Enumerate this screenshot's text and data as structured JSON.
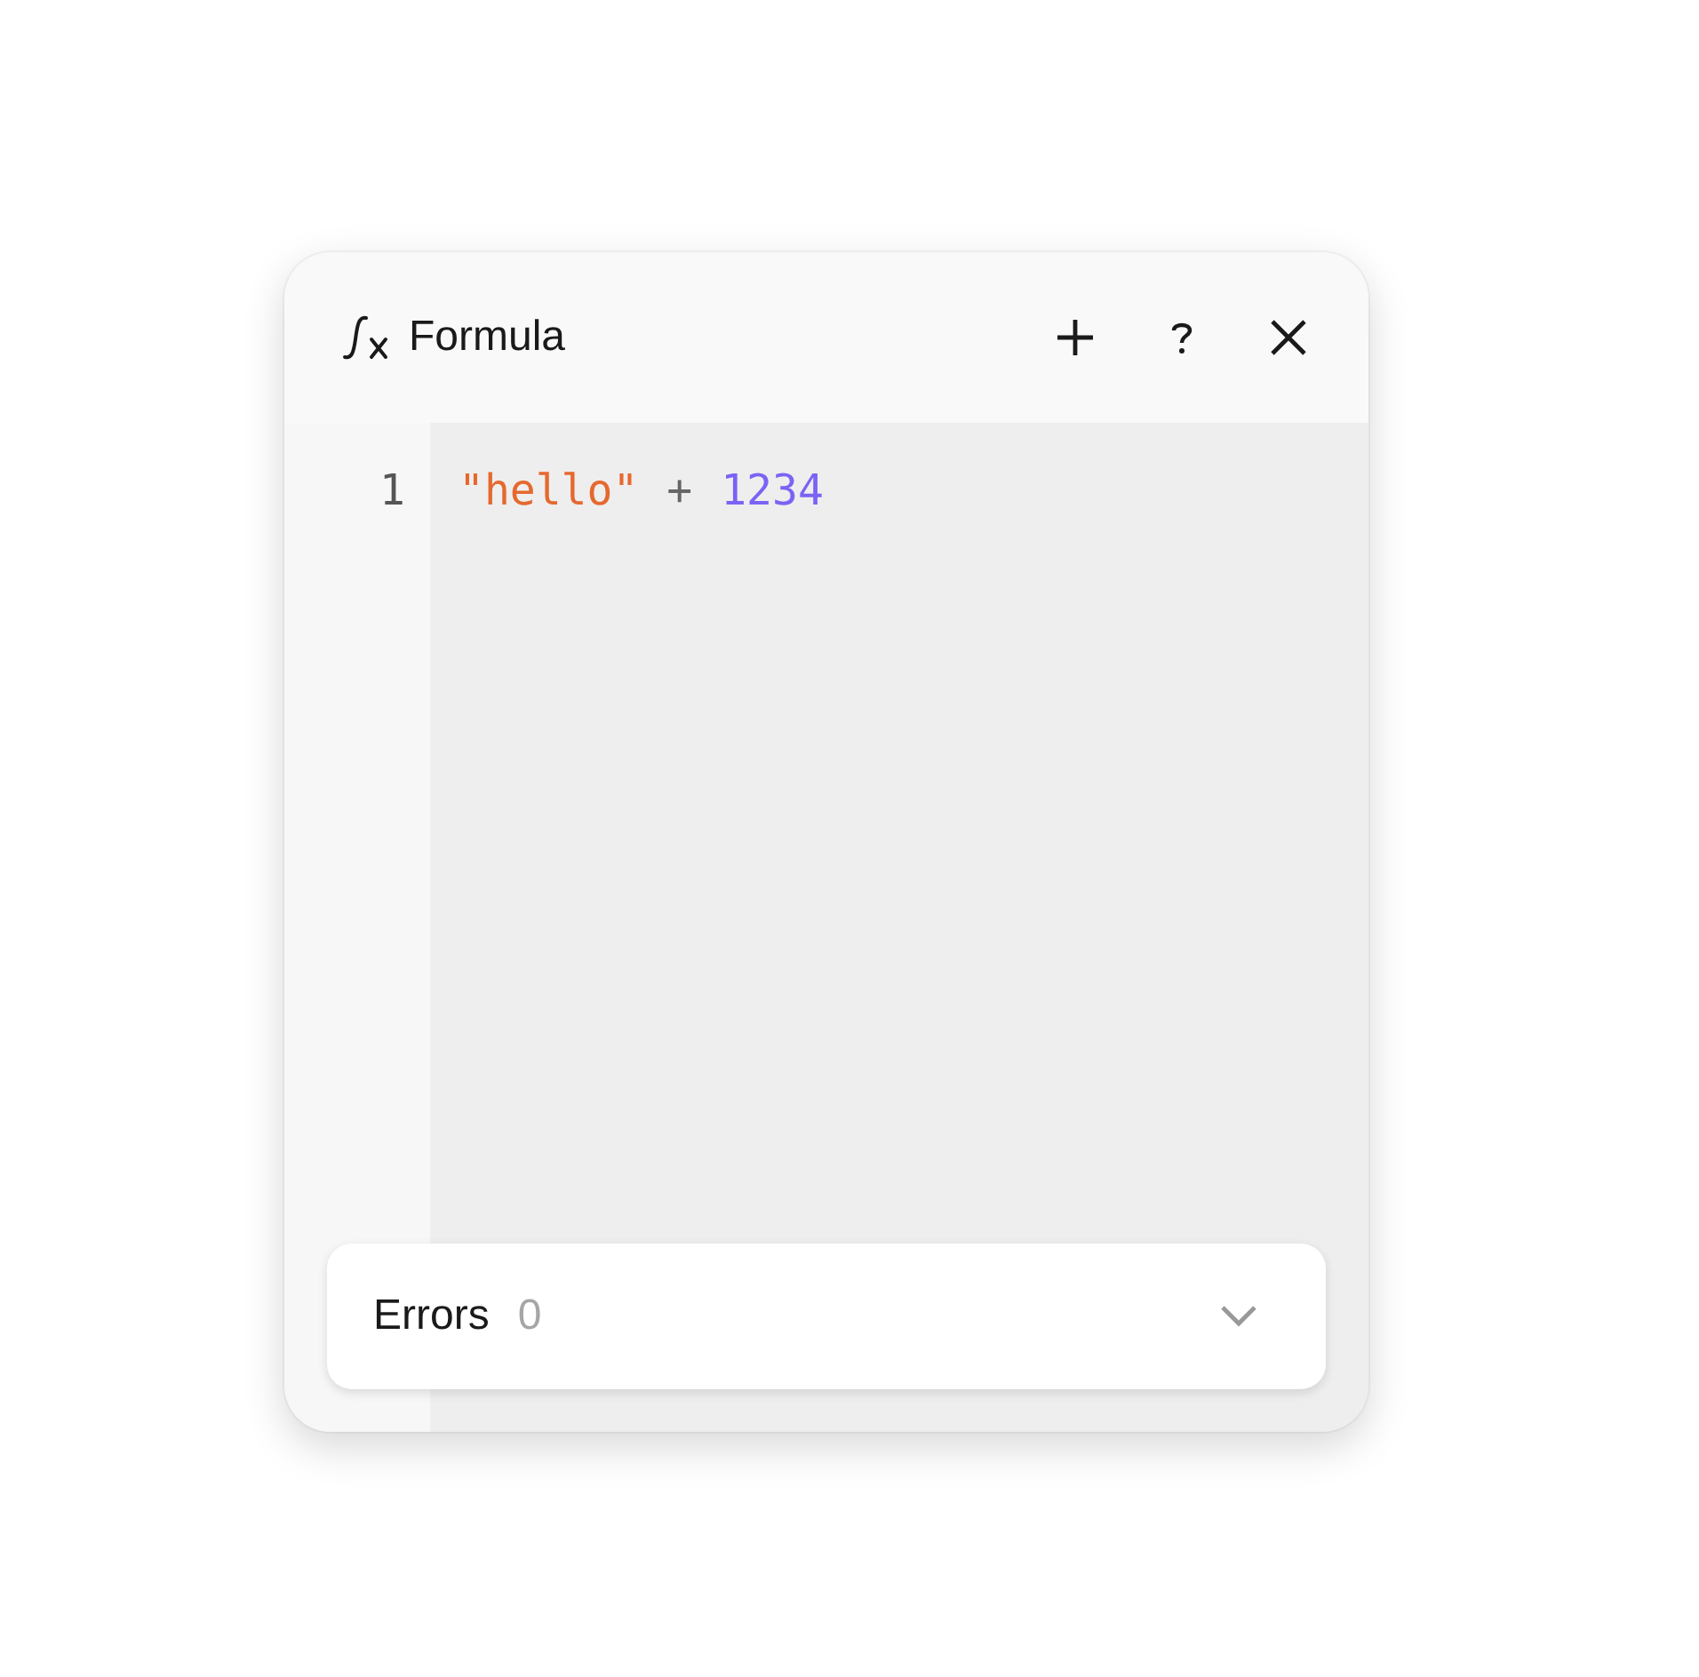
{
  "panel": {
    "title": "Formula"
  },
  "editor": {
    "lines": [
      {
        "number": "1",
        "tokens": [
          {
            "kind": "string",
            "text": "\"hello\""
          },
          {
            "kind": "operator",
            "text": "+"
          },
          {
            "kind": "number",
            "text": "1234"
          }
        ]
      }
    ]
  },
  "errors": {
    "label": "Errors",
    "count": "0",
    "expanded": false
  }
}
